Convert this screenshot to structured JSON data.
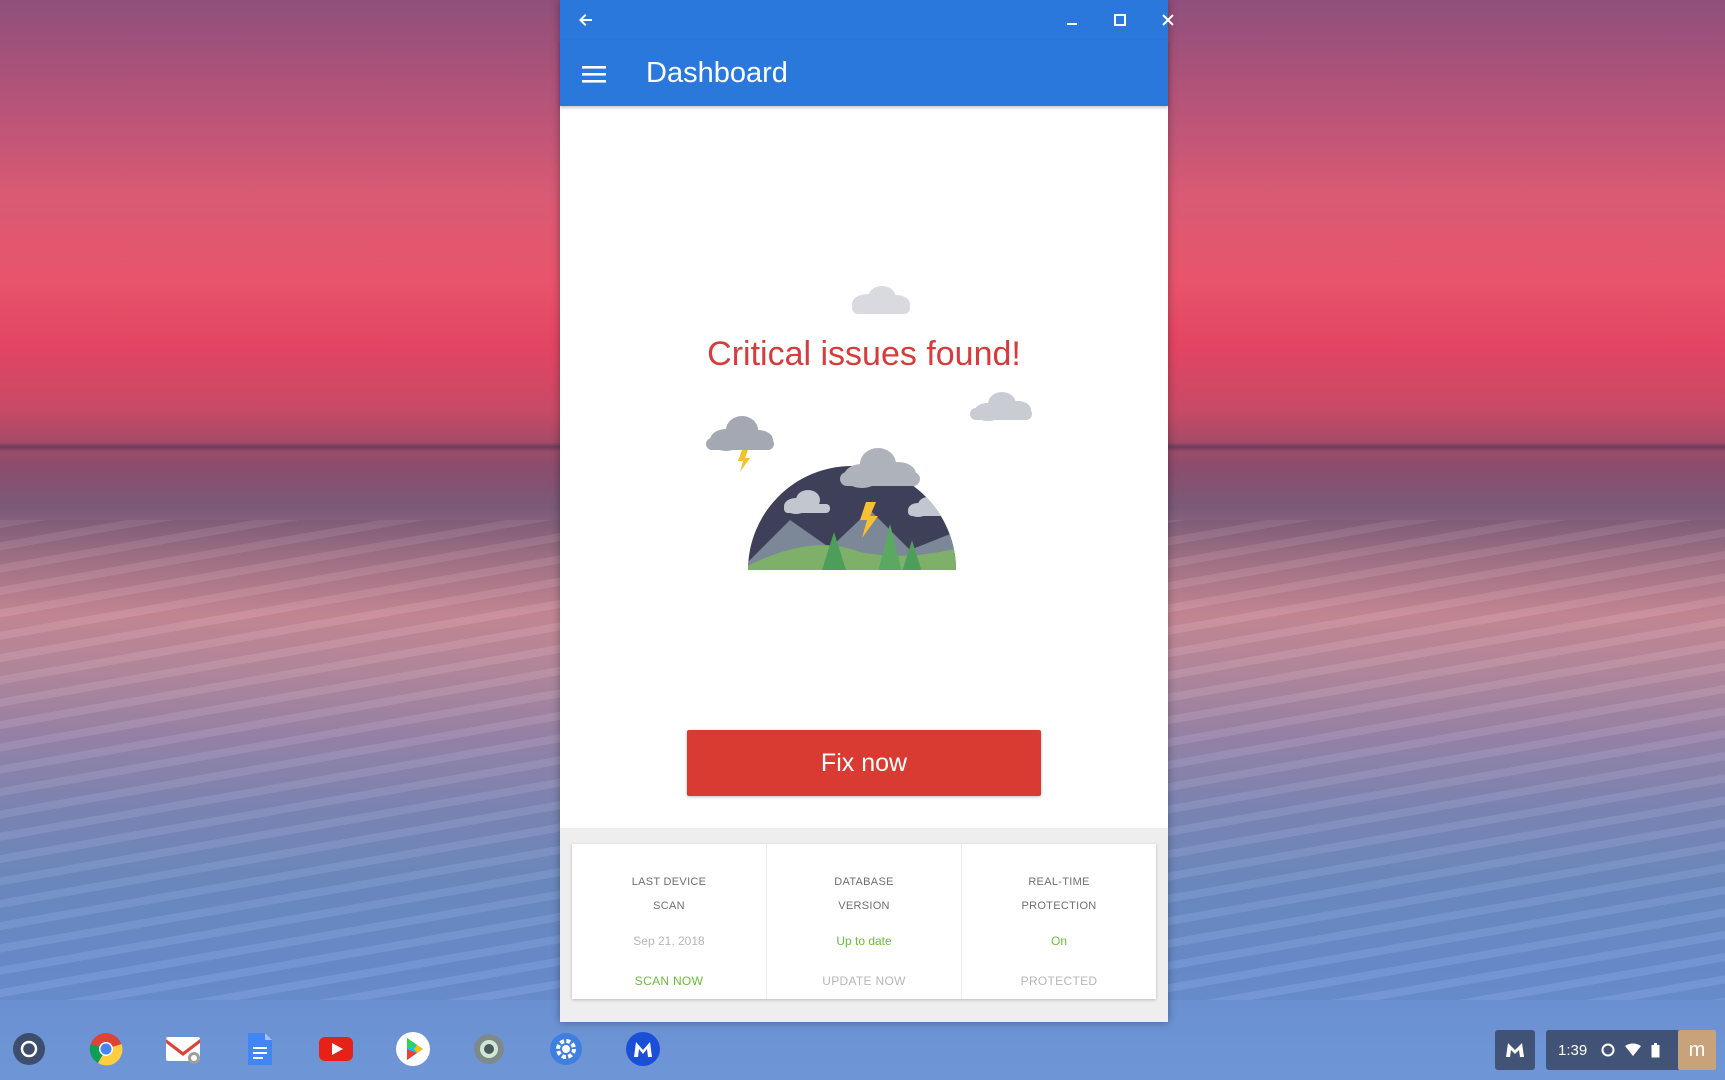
{
  "window": {
    "app_title": "Dashboard"
  },
  "main": {
    "headline": "Critical issues found!",
    "fix_button": "Fix now"
  },
  "status_card": {
    "columns": [
      {
        "label_line1": "LAST DEVICE",
        "label_line2": "SCAN",
        "value": "Sep 21, 2018",
        "action": "SCAN NOW"
      },
      {
        "label_line1": "DATABASE",
        "label_line2": "VERSION",
        "value": "Up to date",
        "action": "UPDATE NOW"
      },
      {
        "label_line1": "REAL-TIME",
        "label_line2": "PROTECTION",
        "value": "On",
        "action": "PROTECTED"
      }
    ]
  },
  "shelf": {
    "apps": [
      "launcher-icon",
      "chrome-icon",
      "gmail-icon",
      "docs-icon",
      "youtube-icon",
      "play-store-icon",
      "camera-icon",
      "settings-icon",
      "malwarebytes-icon"
    ],
    "clock": "1:39",
    "avatar_letter": "m"
  },
  "colors": {
    "accent": "#2a78dc",
    "danger": "#d93a31",
    "ok": "#6dbb3a"
  }
}
